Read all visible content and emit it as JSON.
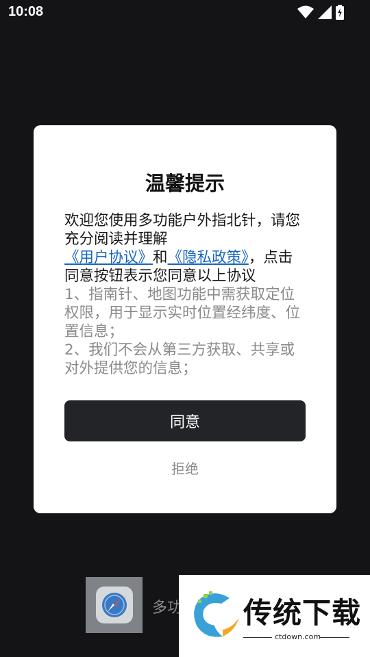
{
  "status_bar": {
    "time": "10:08"
  },
  "background_app": {
    "name": "多功"
  },
  "dialog": {
    "title": "温馨提示",
    "intro": "欢迎您使用多功能户外指北针，请您充分阅读并理解",
    "user_agreement_link": "《用户协议》",
    "and_text": "和",
    "privacy_policy_link": "《隐私政策》",
    "consent_text": "，点击同意按钮表示您同意以上协议",
    "point_1": "1、指南针、地图功能中需获取定位权限，用于显示实时位置经纬度、位置信息；",
    "point_2": "2、我们不会从第三方获取、共享或对外提供您的信息；",
    "agree_label": "同意",
    "refuse_label": "拒绝"
  },
  "watermark": {
    "brand": "传统下载",
    "url": "ctdown.com"
  }
}
